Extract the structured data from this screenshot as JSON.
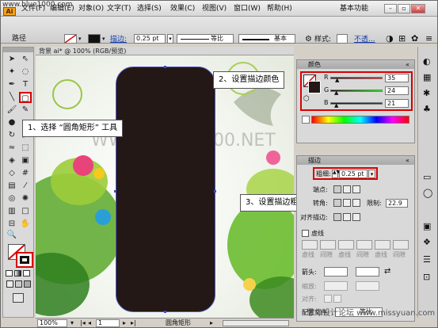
{
  "watermark": "思缘设计论坛 www.missyuan.com",
  "site": "www.blue1000.com",
  "app_logo": "Ai",
  "menu": [
    "文件(F)",
    "编辑(E)",
    "对象(O)",
    "文字(T)",
    "选择(S)",
    "效果(C)",
    "视图(V)",
    "窗口(W)",
    "帮助(H)"
  ],
  "workspace_label": "基本功能",
  "control": {
    "object_type": "路径",
    "stroke_label": "描边:",
    "stroke_value": "0.25 pt",
    "profile_label": "等比",
    "brush_label": "基本",
    "style_label": "样式:",
    "opacity_label": "不透..."
  },
  "document_tab": "背景 ai* @ 100% (RGB/预览)",
  "canvas_watermark": "WWW.BLUE1000.NET",
  "callouts": {
    "step1": "1、选择 “圆角矩形” 工具",
    "step2": "2、设置描边颜色",
    "step3": "3、设置描边粗细"
  },
  "color_panel": {
    "title": "颜色",
    "r_label": "R",
    "r_value": "35",
    "g_label": "G",
    "g_value": "24",
    "b_label": "B",
    "b_value": "21"
  },
  "stroke_panel": {
    "title": "描边",
    "weight_label": "粗细:",
    "weight_value": "0.25 pt",
    "cap_label": "端点:",
    "join_label": "转角:",
    "limit_label": "限制:",
    "limit_value": "22.9",
    "align_label": "对齐描边:",
    "dash_label": "虚线",
    "dash_cells": [
      "虚线",
      "间隙",
      "虚线",
      "间隙",
      "虚线",
      "间隙"
    ],
    "arrow_label": "箭头:",
    "scale_label": "缩放:",
    "align2_label": "对齐:",
    "profile_label": "配置文件:",
    "profile_value": "等比"
  },
  "status": {
    "zoom": "100%",
    "page": "1",
    "tool": "圆角矩形"
  },
  "colors": {
    "shape_fill": "#231815",
    "accent_red": "#d80000"
  }
}
